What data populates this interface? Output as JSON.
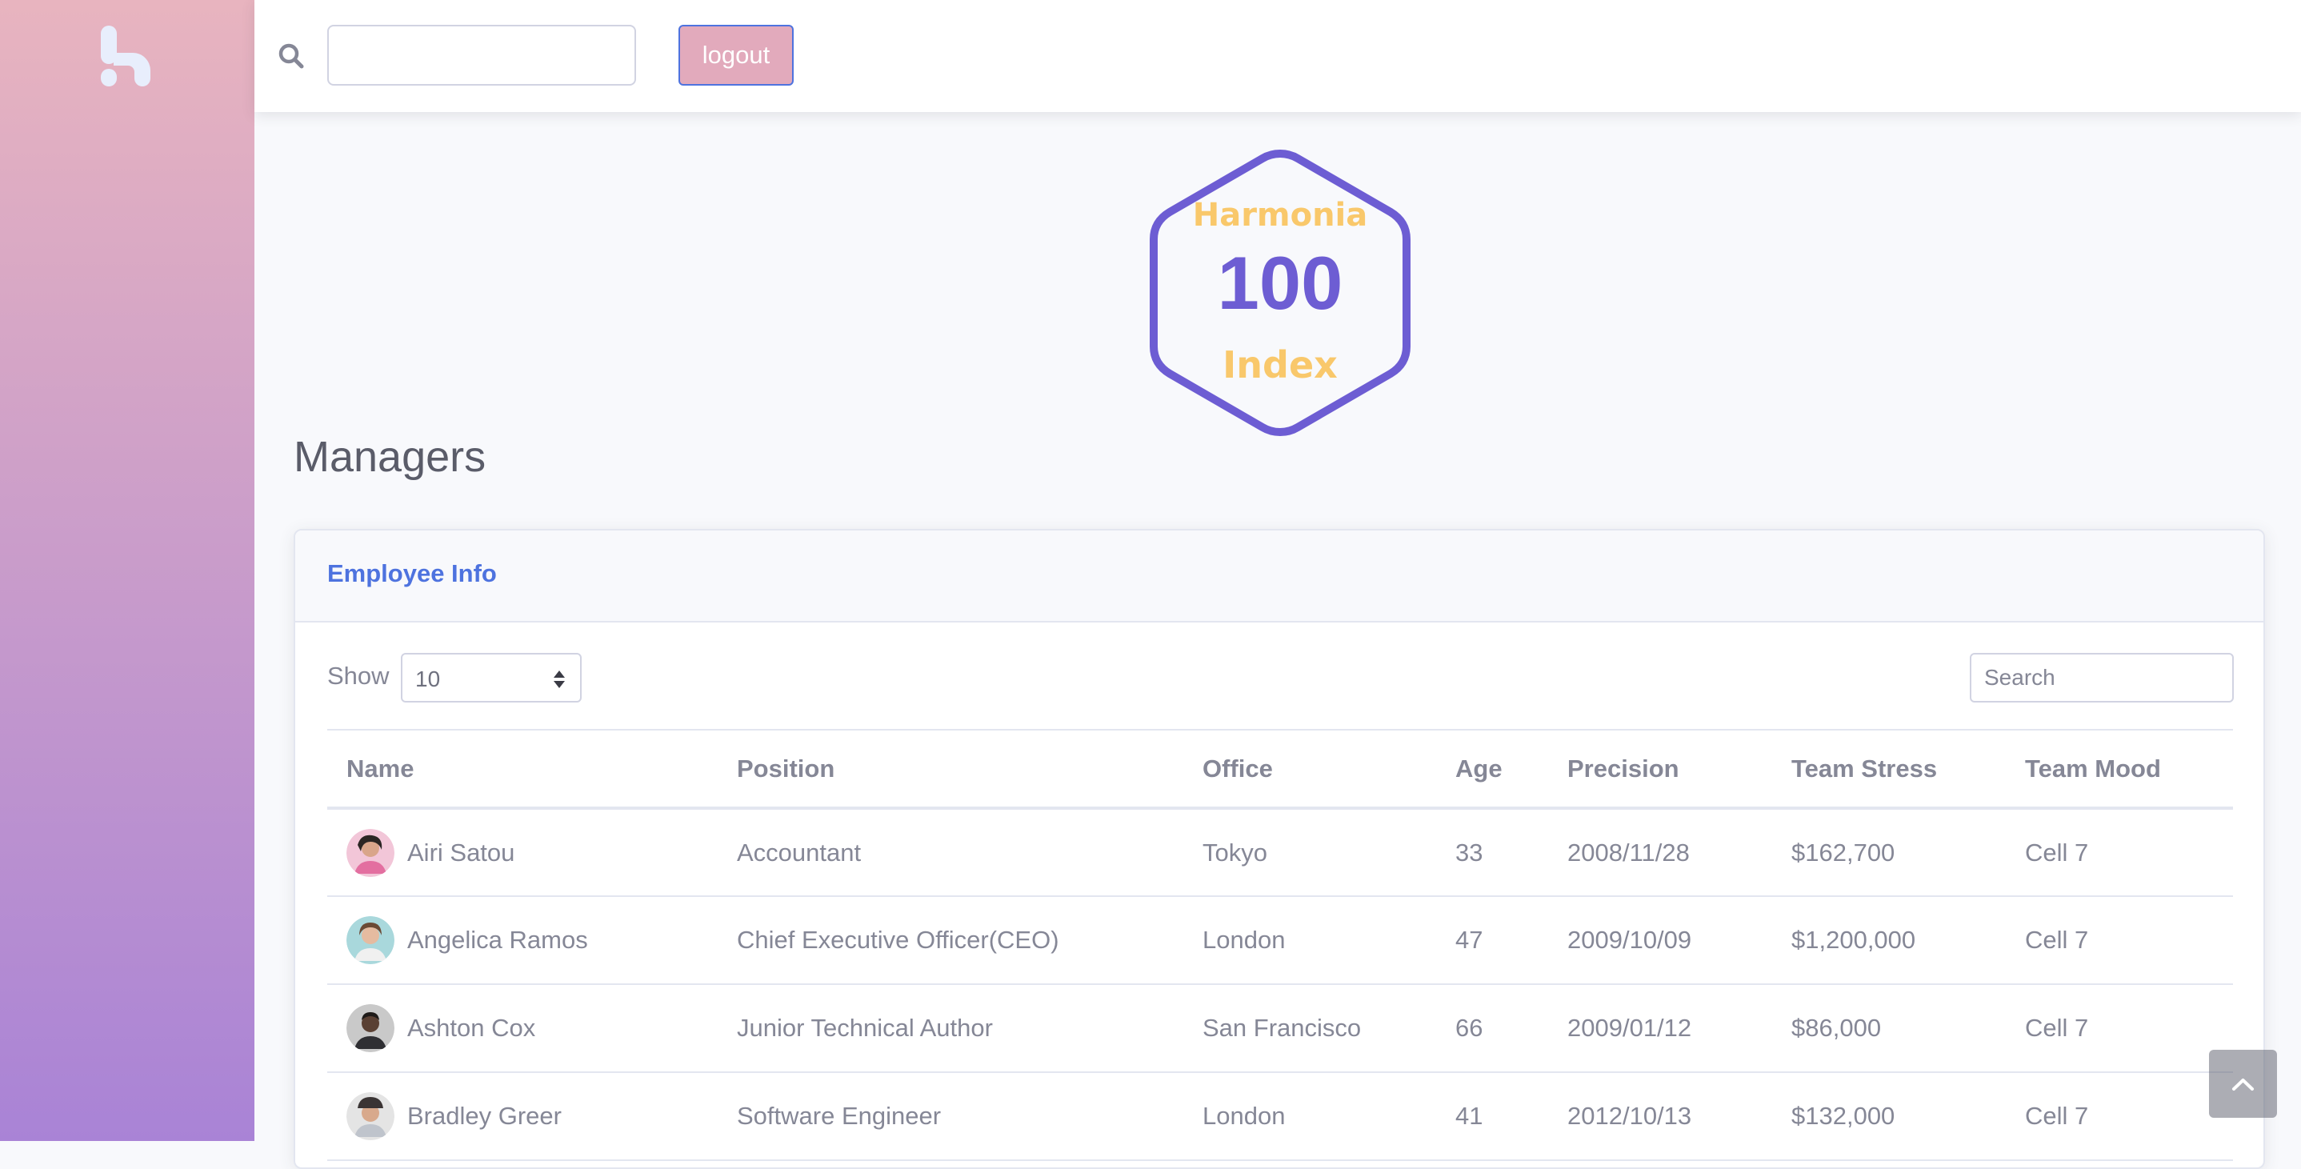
{
  "topbar": {
    "search_value": "",
    "logout_label": "logout"
  },
  "badge": {
    "line1": "Harmonia",
    "value": "100",
    "line2": "Index"
  },
  "page": {
    "title": "Managers"
  },
  "card": {
    "title": "Employee Info",
    "show_label": "Show",
    "page_length": "10",
    "search_placeholder": "Search"
  },
  "table": {
    "columns": [
      "Name",
      "Position",
      "Office",
      "Age",
      "Precision",
      "Team Stress",
      "Team Mood"
    ],
    "rows": [
      {
        "name": "Airi Satou",
        "position": "Accountant",
        "office": "Tokyo",
        "age": "33",
        "precision": "2008/11/28",
        "stress": "$162,700",
        "mood": "Cell 7"
      },
      {
        "name": "Angelica Ramos",
        "position": "Chief Executive Officer(CEO)",
        "office": "London",
        "age": "47",
        "precision": "2009/10/09",
        "stress": "$1,200,000",
        "mood": "Cell 7"
      },
      {
        "name": "Ashton Cox",
        "position": "Junior Technical Author",
        "office": "San Francisco",
        "age": "66",
        "precision": "2009/01/12",
        "stress": "$86,000",
        "mood": "Cell 7"
      },
      {
        "name": "Bradley Greer",
        "position": "Software Engineer",
        "office": "London",
        "age": "41",
        "precision": "2012/10/13",
        "stress": "$132,000",
        "mood": "Cell 7"
      }
    ]
  },
  "colors": {
    "primary": "#4e73df",
    "badge_outline": "#6d5dd3",
    "badge_accent": "#f9c86b",
    "sidebar_top": "#e8b4bf",
    "sidebar_bottom": "#a983d6",
    "logout_bg": "#e2aabc"
  },
  "icons": {
    "brand": "brand-logo",
    "search": "search-icon",
    "select": "sort-arrows-icon",
    "scroll": "chevron-up-icon"
  }
}
